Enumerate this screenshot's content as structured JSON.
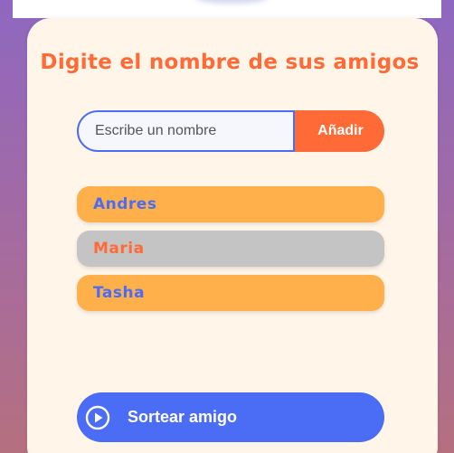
{
  "header": {
    "title": "Digite el nombre de sus amigos"
  },
  "input": {
    "placeholder": "Escribe un nombre",
    "value": ""
  },
  "add_button": {
    "label": "Añadir"
  },
  "friends": [
    {
      "name": "Andres",
      "state": "default"
    },
    {
      "name": "Maria",
      "state": "selected"
    },
    {
      "name": "Tasha",
      "state": "default"
    }
  ],
  "draw_button": {
    "label": "Sortear amigo",
    "icon": "play-circle-icon"
  },
  "colors": {
    "accent_orange": "#ff6a36",
    "accent_blue": "#4b6cf4",
    "item_orange": "#ffb04a",
    "item_selected_gray": "#c4c4c4",
    "card_background": "#fff6e9"
  }
}
